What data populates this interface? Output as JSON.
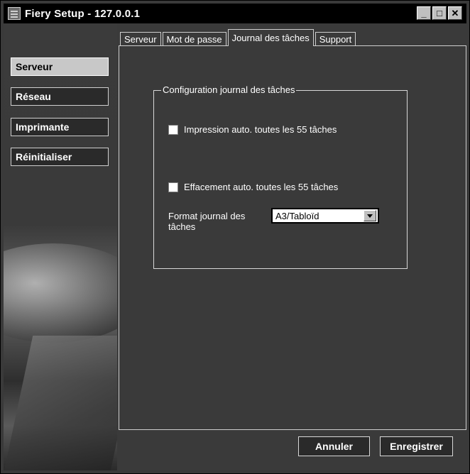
{
  "window": {
    "title": "Fiery Setup - 127.0.0.1"
  },
  "sidebar": {
    "items": [
      {
        "label": "Serveur",
        "active": true
      },
      {
        "label": "Réseau",
        "active": false
      },
      {
        "label": "Imprimante",
        "active": false
      },
      {
        "label": "Réinitialiser",
        "active": false
      }
    ]
  },
  "tabs": [
    {
      "label": "Serveur",
      "active": false
    },
    {
      "label": "Mot de passe",
      "active": false
    },
    {
      "label": "Journal des tâches",
      "active": true
    },
    {
      "label": "Support",
      "active": false
    }
  ],
  "group": {
    "label": "Configuration journal des tâches",
    "auto_print_label": "Impression auto. toutes les 55 tâches",
    "auto_print_checked": false,
    "auto_clear_label": "Effacement auto. toutes les 55 tâches",
    "auto_clear_checked": false,
    "format_label": "Format journal des tâches",
    "format_value": "A3/Tabloïd"
  },
  "footer": {
    "cancel_label": "Annuler",
    "save_label": "Enregistrer"
  },
  "colors": {
    "background": "#3a3a3a",
    "titlebar": "#000000",
    "active_nav": "#c8c8c8"
  }
}
